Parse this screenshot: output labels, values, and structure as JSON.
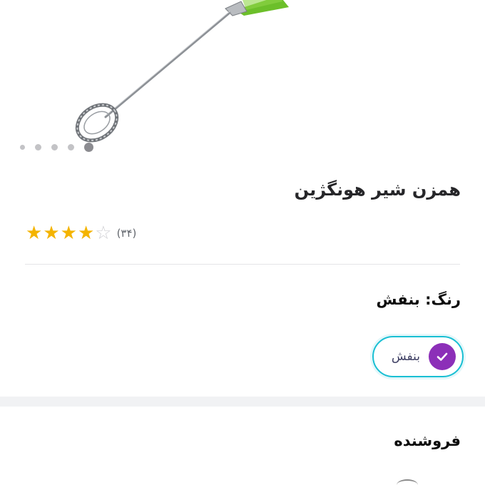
{
  "product": {
    "title": "همزن شیر هونگژین",
    "image_alt": "milk-frother",
    "gallery": {
      "dot_count": 5,
      "active_index": 4
    }
  },
  "rating": {
    "stars": 4,
    "max_stars": 5,
    "review_count": "(۳۴)"
  },
  "color": {
    "label": "رنگ: بنفش",
    "options": [
      {
        "name": "بنفش",
        "swatch": "#8c2fb8",
        "selected": true
      }
    ],
    "selected_border_color": "#19bfd3"
  },
  "seller": {
    "title": "فروشنده"
  },
  "theme": {
    "star_color": "#f4b400",
    "handle_green": "#6cbf2a"
  }
}
